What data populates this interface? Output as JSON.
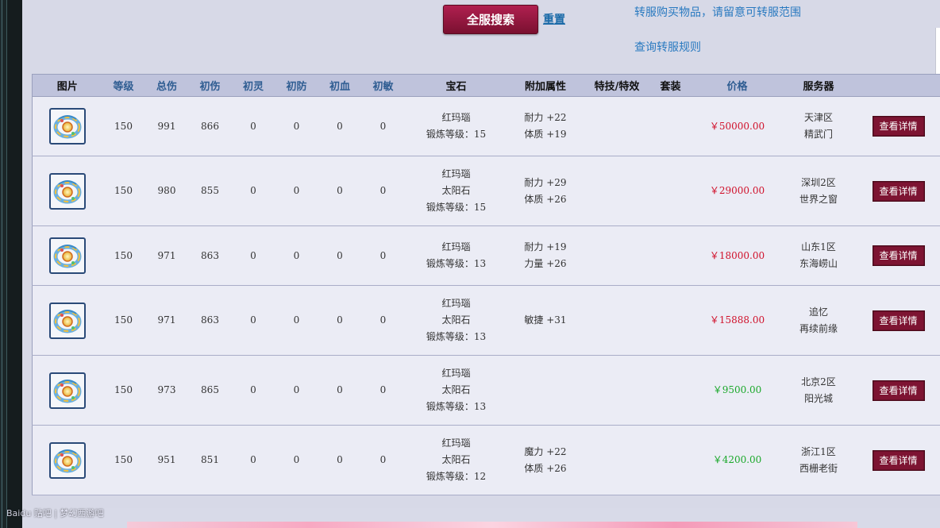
{
  "toolbar": {
    "search_label": "全服搜索",
    "reset_label": "重置",
    "notice": "转服购买物品，请留意可转服范围",
    "rules_link": "查询转服规则"
  },
  "table": {
    "headers": [
      "图片",
      "等级",
      "总伤",
      "初伤",
      "初灵",
      "初防",
      "初血",
      "初敏",
      "宝石",
      "附加属性",
      "特技/特效",
      "套装",
      "价格",
      "服务器",
      ""
    ],
    "detail_label": "查看详情",
    "rows": [
      {
        "level": "150",
        "total": "991",
        "dmg": "866",
        "ling": "0",
        "def": "0",
        "hp": "0",
        "agi": "0",
        "gem": [
          "红玛瑙",
          "锻炼等级：15"
        ],
        "attrs": [
          "耐力 +22",
          "体质 +19"
        ],
        "skill": "",
        "set": "",
        "price": "￥50000.00",
        "price_color": "#d0102a",
        "server": [
          "天津区",
          "精武门"
        ]
      },
      {
        "level": "150",
        "total": "980",
        "dmg": "855",
        "ling": "0",
        "def": "0",
        "hp": "0",
        "agi": "0",
        "gem": [
          "红玛瑙",
          "太阳石",
          "锻炼等级：15"
        ],
        "attrs": [
          "耐力 +29",
          "体质 +26"
        ],
        "skill": "",
        "set": "",
        "price": "￥29000.00",
        "price_color": "#d0102a",
        "server": [
          "深圳2区",
          "世界之窗"
        ]
      },
      {
        "level": "150",
        "total": "971",
        "dmg": "863",
        "ling": "0",
        "def": "0",
        "hp": "0",
        "agi": "0",
        "gem": [
          "红玛瑙",
          "锻炼等级：13"
        ],
        "attrs": [
          "耐力 +19",
          "力量 +26"
        ],
        "skill": "",
        "set": "",
        "price": "￥18000.00",
        "price_color": "#d0102a",
        "server": [
          "山东1区",
          "东海崂山"
        ]
      },
      {
        "level": "150",
        "total": "971",
        "dmg": "863",
        "ling": "0",
        "def": "0",
        "hp": "0",
        "agi": "0",
        "gem": [
          "红玛瑙",
          "太阳石",
          "锻炼等级：13"
        ],
        "attrs": [
          "敏捷 +31"
        ],
        "skill": "",
        "set": "",
        "price": "￥15888.00",
        "price_color": "#d0102a",
        "server": [
          "追忆",
          "再续前缘"
        ]
      },
      {
        "level": "150",
        "total": "973",
        "dmg": "865",
        "ling": "0",
        "def": "0",
        "hp": "0",
        "agi": "0",
        "gem": [
          "红玛瑙",
          "太阳石",
          "锻炼等级：13"
        ],
        "attrs": [],
        "skill": "",
        "set": "",
        "price": "￥9500.00",
        "price_color": "#1aa82a",
        "server": [
          "北京2区",
          "阳光城"
        ]
      },
      {
        "level": "150",
        "total": "951",
        "dmg": "851",
        "ling": "0",
        "def": "0",
        "hp": "0",
        "agi": "0",
        "gem": [
          "红玛瑙",
          "太阳石",
          "锻炼等级：12"
        ],
        "attrs": [
          "魔力 +22",
          "体质 +26"
        ],
        "skill": "",
        "set": "",
        "price": "￥4200.00",
        "price_color": "#1aa82a",
        "server": [
          "浙江1区",
          "西栅老街"
        ]
      }
    ]
  },
  "watermark": "Baidu 贴吧 | 梦幻西游吧",
  "item_icon": "ring-icon"
}
